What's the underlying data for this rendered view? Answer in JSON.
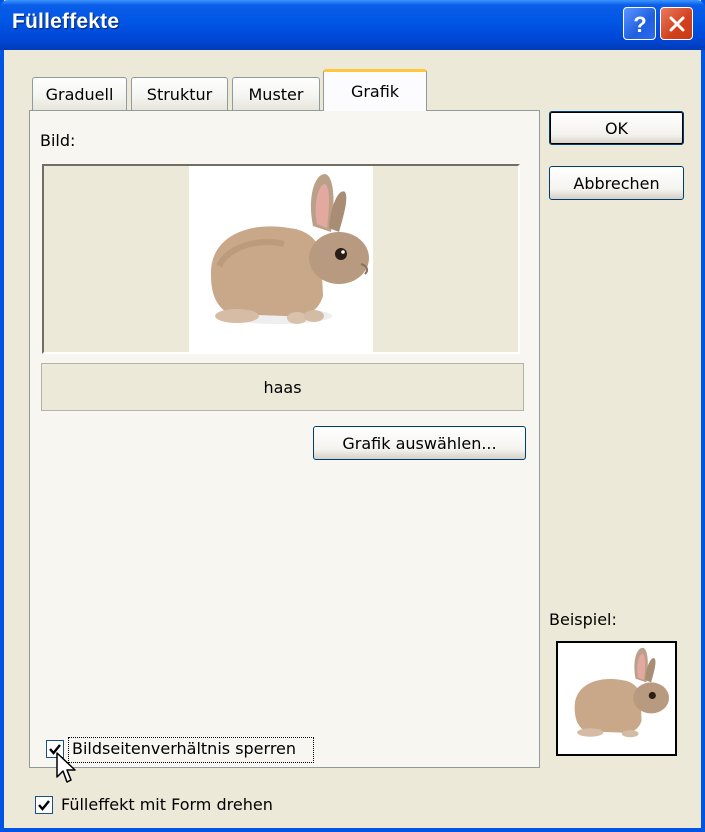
{
  "window": {
    "title": "Fülleffekte",
    "title_color": "#0054e3"
  },
  "tabs": [
    {
      "label": "Graduell",
      "active": false
    },
    {
      "label": "Struktur",
      "active": false
    },
    {
      "label": "Muster",
      "active": false
    },
    {
      "label": "Grafik",
      "active": true
    }
  ],
  "panel": {
    "picture_label": "Bild:",
    "picture_name": "haas",
    "select_button": "Grafik auswählen...",
    "lock_aspect_label": "Bildseitenverhältnis sperren",
    "lock_aspect_checked": true
  },
  "buttons": {
    "ok": "OK",
    "cancel": "Abbrechen"
  },
  "sample_label": "Beispiel:",
  "rotate_label": "Fülleffekt mit Form drehen",
  "rotate_checked": true,
  "icons": [
    "help-icon",
    "close-icon",
    "checkmark-icon",
    "mouse-cursor-icon",
    "rabbit-image"
  ]
}
